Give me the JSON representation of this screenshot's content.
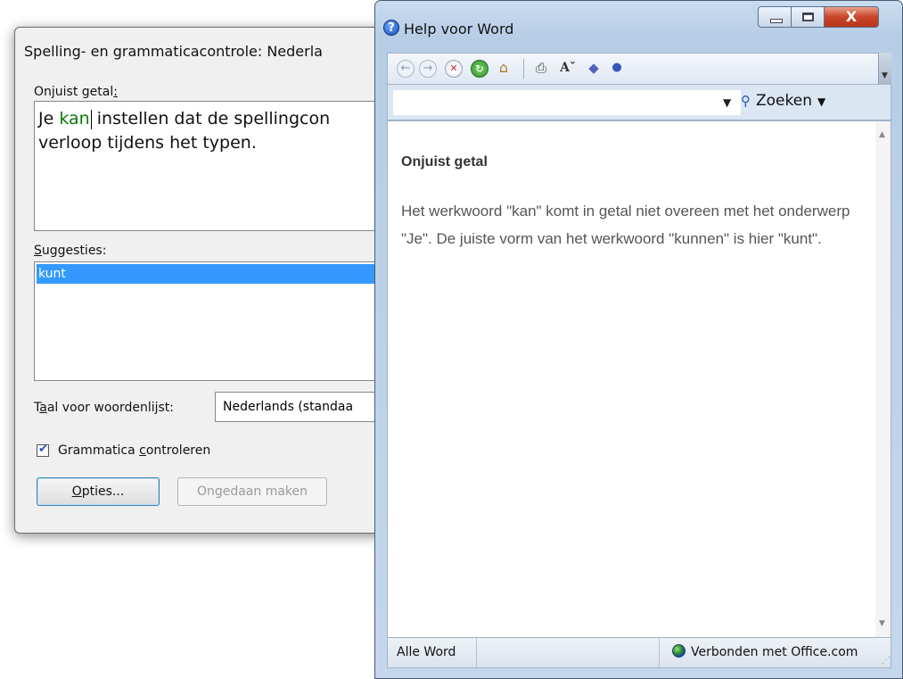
{
  "spell_dialog": {
    "title": "Spelling- en grammaticacontrole: Nederla",
    "error_label": "Onjuist getal",
    "error_label_colon": ":",
    "sentence": {
      "before": "Je ",
      "error_word": "kan",
      "after_line1": " instellen dat de spellingcon",
      "line2": "verloop tijdens het typen."
    },
    "suggestions_label_first": "S",
    "suggestions_label_rest": "uggesties:",
    "suggestions": [
      "kunt"
    ],
    "lang_label_pre": "T",
    "lang_label_ul": "a",
    "lang_label_post": "al voor woordenlijst:",
    "lang_value": "Nederlands (standaa",
    "check_grammar_pre": "Grammatica ",
    "check_grammar_ul": "c",
    "check_grammar_post": "ontroleren",
    "check_grammar_checked": true,
    "options_button_ul": "O",
    "options_button_rest": "pties...",
    "undo_button": "Ongedaan maken"
  },
  "help_window": {
    "title": "Help voor Word",
    "close_glyph": "X",
    "search_placeholder": "",
    "search_button": "Zoeken",
    "content_title": "Onjuist getal",
    "content_body": "Het werkwoord \"kan\" komt in getal niet overeen met het onderwerp \"Je\". De juiste vorm van het werkwoord \"kunnen\" is hier \"kunt\".",
    "status_left": "Alle Word",
    "status_right": "Verbonden met Office.com"
  },
  "icons": {
    "back": "back-icon",
    "forward": "forward-icon",
    "stop": "stop-icon",
    "refresh": "refresh-icon",
    "home": "home-icon",
    "print": "print-icon",
    "font_size": "font-size-icon",
    "toc": "book-icon",
    "pin": "pin-icon"
  },
  "colors": {
    "error_word": "#0a7a0a",
    "selection": "#3399ff",
    "close_button": "#c9452a"
  }
}
